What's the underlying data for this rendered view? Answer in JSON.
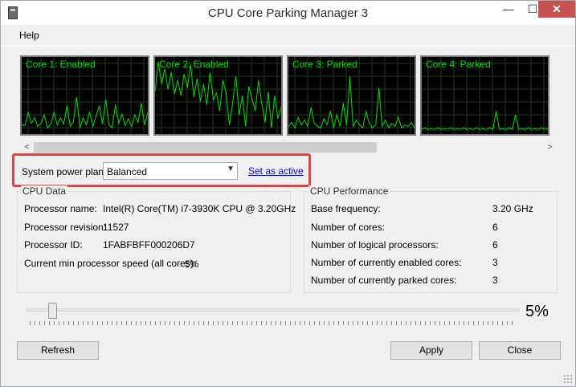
{
  "window": {
    "title": "CPU Core Parking Manager 3"
  },
  "titlebar": {
    "minimize": "—",
    "maximize": "☐",
    "close": "✕"
  },
  "menu": {
    "help": "Help"
  },
  "graph_color": "#00e000",
  "cores": [
    {
      "label": "Core 1: Enabled",
      "points": [
        88,
        89,
        72,
        86,
        79,
        90,
        86,
        75,
        92,
        87,
        72,
        88,
        79,
        87,
        63,
        90,
        84,
        52,
        92,
        79,
        88,
        71,
        90,
        77,
        63,
        87,
        55,
        88,
        92,
        62,
        86,
        74,
        89,
        80,
        90,
        75,
        85,
        60,
        88,
        72
      ]
    },
    {
      "label": "Core 2: Enabled",
      "points": [
        45,
        6,
        35,
        15,
        42,
        20,
        48,
        30,
        50,
        22,
        40,
        10,
        52,
        28,
        58,
        35,
        62,
        20,
        55,
        47,
        70,
        30,
        48,
        88,
        60,
        25,
        75,
        50,
        90,
        38,
        55,
        70,
        30,
        60,
        85,
        45,
        92,
        50,
        80,
        65
      ]
    },
    {
      "label": "Core 3: Parked",
      "points": [
        90,
        85,
        92,
        78,
        88,
        82,
        90,
        65,
        86,
        90,
        92,
        80,
        88,
        70,
        92,
        75,
        90,
        60,
        88,
        25,
        90,
        82,
        88,
        92,
        70,
        86,
        92,
        88,
        40,
        90,
        82,
        92,
        86,
        90,
        78,
        92,
        88,
        90,
        85,
        92
      ]
    },
    {
      "label": "Core 4: Parked",
      "points": [
        94,
        92,
        94,
        93,
        94,
        92,
        94,
        93,
        94,
        92,
        94,
        93,
        94,
        92,
        94,
        93,
        94,
        92,
        94,
        93,
        94,
        92,
        94,
        70,
        94,
        93,
        94,
        92,
        94,
        75,
        94,
        93,
        94,
        92,
        94,
        93,
        94,
        92,
        94,
        93
      ]
    }
  ],
  "scroll": {
    "left": "<",
    "right": ">"
  },
  "power_plan": {
    "label": "System power plan:",
    "selected": "Balanced",
    "set_active": "Set as active"
  },
  "cpu_data": {
    "title": "CPU Data",
    "rows": [
      {
        "label": "Processor name:",
        "value": "Intel(R) Core(TM) i7-3930K CPU @ 3.20GHz"
      },
      {
        "label": "Processor revision:",
        "value": "11527"
      },
      {
        "label": "Processor ID:",
        "value": "1FABFBFF000206D7"
      },
      {
        "label": "Current min processor speed (all cores):",
        "value": "5%"
      }
    ]
  },
  "cpu_performance": {
    "title": "CPU Performance",
    "rows": [
      {
        "label": "Base frequency:",
        "value": "3.20 GHz"
      },
      {
        "label": "Number of cores:",
        "value": "6"
      },
      {
        "label": "Number of logical processors:",
        "value": "6"
      },
      {
        "label": "Number of currently enabled cores:",
        "value": "3"
      },
      {
        "label": "Number of currently parked cores:",
        "value": "3"
      }
    ]
  },
  "slider": {
    "value_percent": 5,
    "label": "5%"
  },
  "buttons": {
    "refresh": "Refresh",
    "apply": "Apply",
    "close": "Close"
  }
}
